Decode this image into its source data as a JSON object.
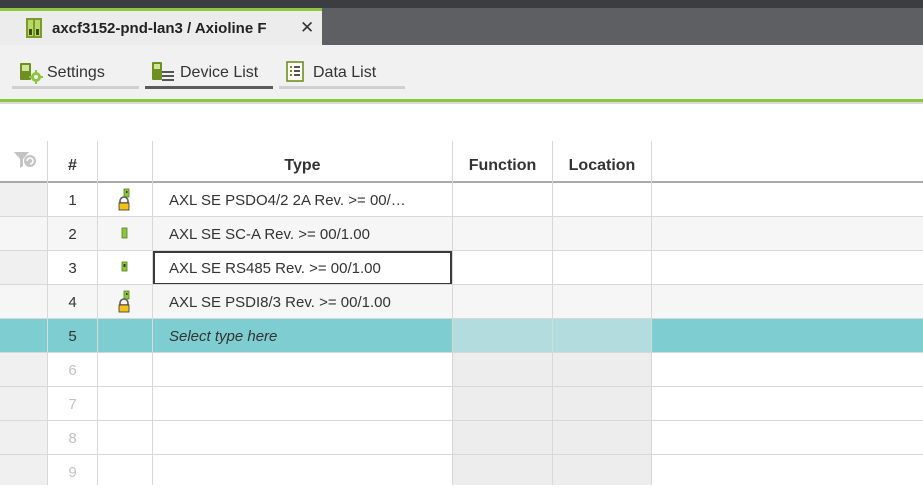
{
  "window": {
    "doc_tab_title": "axcf3152-pnd-lan3 / Axioline F",
    "close_glyph": "✕"
  },
  "subtabs": [
    {
      "label": "Settings",
      "icon": "settings-gear-icon"
    },
    {
      "label": "Device List",
      "icon": "device-list-icon"
    },
    {
      "label": "Data List",
      "icon": "data-list-icon"
    }
  ],
  "columns": {
    "num": "#",
    "icon": "",
    "type": "Type",
    "function": "Function",
    "location": "Location"
  },
  "rows": [
    {
      "num": "1",
      "type": "AXL SE PSDO4/2 2A Rev. >= 00/…",
      "icon": "safety-module-icon"
    },
    {
      "num": "2",
      "type": "AXL SE SC-A Rev. >= 00/1.00",
      "icon": "module-small-icon"
    },
    {
      "num": "3",
      "type": "AXL SE RS485 Rev. >= 00/1.00",
      "icon": "module-icon"
    },
    {
      "num": "4",
      "type": "AXL SE PSDI8/3 Rev. >= 00/1.00",
      "icon": "safety-module-icon"
    },
    {
      "num": "5",
      "type": "Select type here",
      "icon": ""
    },
    {
      "num": "6",
      "type": "",
      "icon": ""
    },
    {
      "num": "7",
      "type": "",
      "icon": ""
    },
    {
      "num": "8",
      "type": "",
      "icon": ""
    },
    {
      "num": "9",
      "type": "",
      "icon": ""
    }
  ],
  "colors": {
    "accent_green": "#8cc63f",
    "selection_teal": "#7ecdd0",
    "tab_bar_dark": "#5d5f62"
  }
}
